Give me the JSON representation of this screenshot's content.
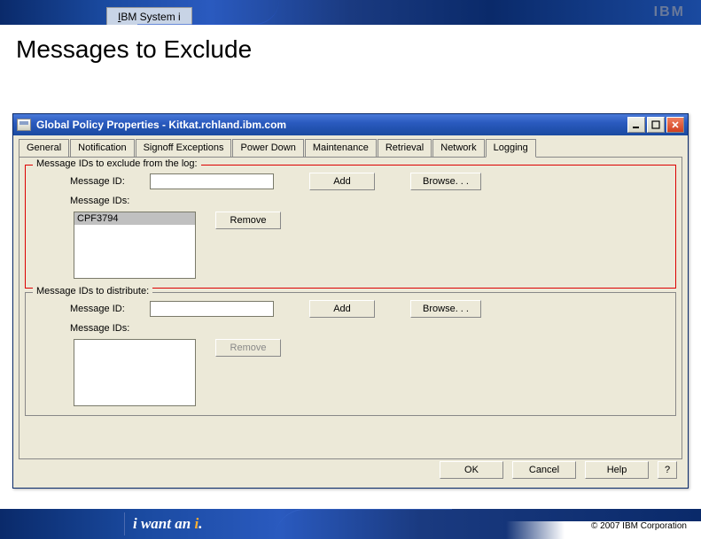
{
  "banner": {
    "product_prefix_underline": "I",
    "product_rest": "BM System i",
    "logo_text": "IBM"
  },
  "slide": {
    "title": "Messages to Exclude"
  },
  "dialog": {
    "title": "Global Policy Properties - Kitkat.rchland.ibm.com",
    "tabs": [
      "General",
      "Notification",
      "Signoff Exceptions",
      "Power Down",
      "Maintenance",
      "Retrieval",
      "Network",
      "Logging"
    ],
    "active_tab_index": 7,
    "group_exclude": {
      "legend": "Message IDs to exclude from the log:",
      "msgid_label": "Message ID:",
      "msgid_value": "",
      "add_label": "Add",
      "browse_label": "Browse. . .",
      "ids_label": "Message IDs:",
      "remove_label": "Remove",
      "list": [
        "CPF3794"
      ],
      "selected_index": 0
    },
    "group_distribute": {
      "legend": "Message IDs to distribute:",
      "msgid_label": "Message ID:",
      "msgid_value": "",
      "add_label": "Add",
      "browse_label": "Browse. . .",
      "ids_label": "Message IDs:",
      "remove_label": "Remove",
      "list": []
    },
    "buttons": {
      "ok": "OK",
      "cancel": "Cancel",
      "help": "Help",
      "context_help": "?"
    },
    "window_controls": {
      "minimize": "_",
      "maximize": "□",
      "close": "×"
    }
  },
  "footer": {
    "slogan_pre": "i want an ",
    "slogan_i": "i",
    "slogan_post": ".",
    "copyright": "© 2007 IBM Corporation"
  }
}
